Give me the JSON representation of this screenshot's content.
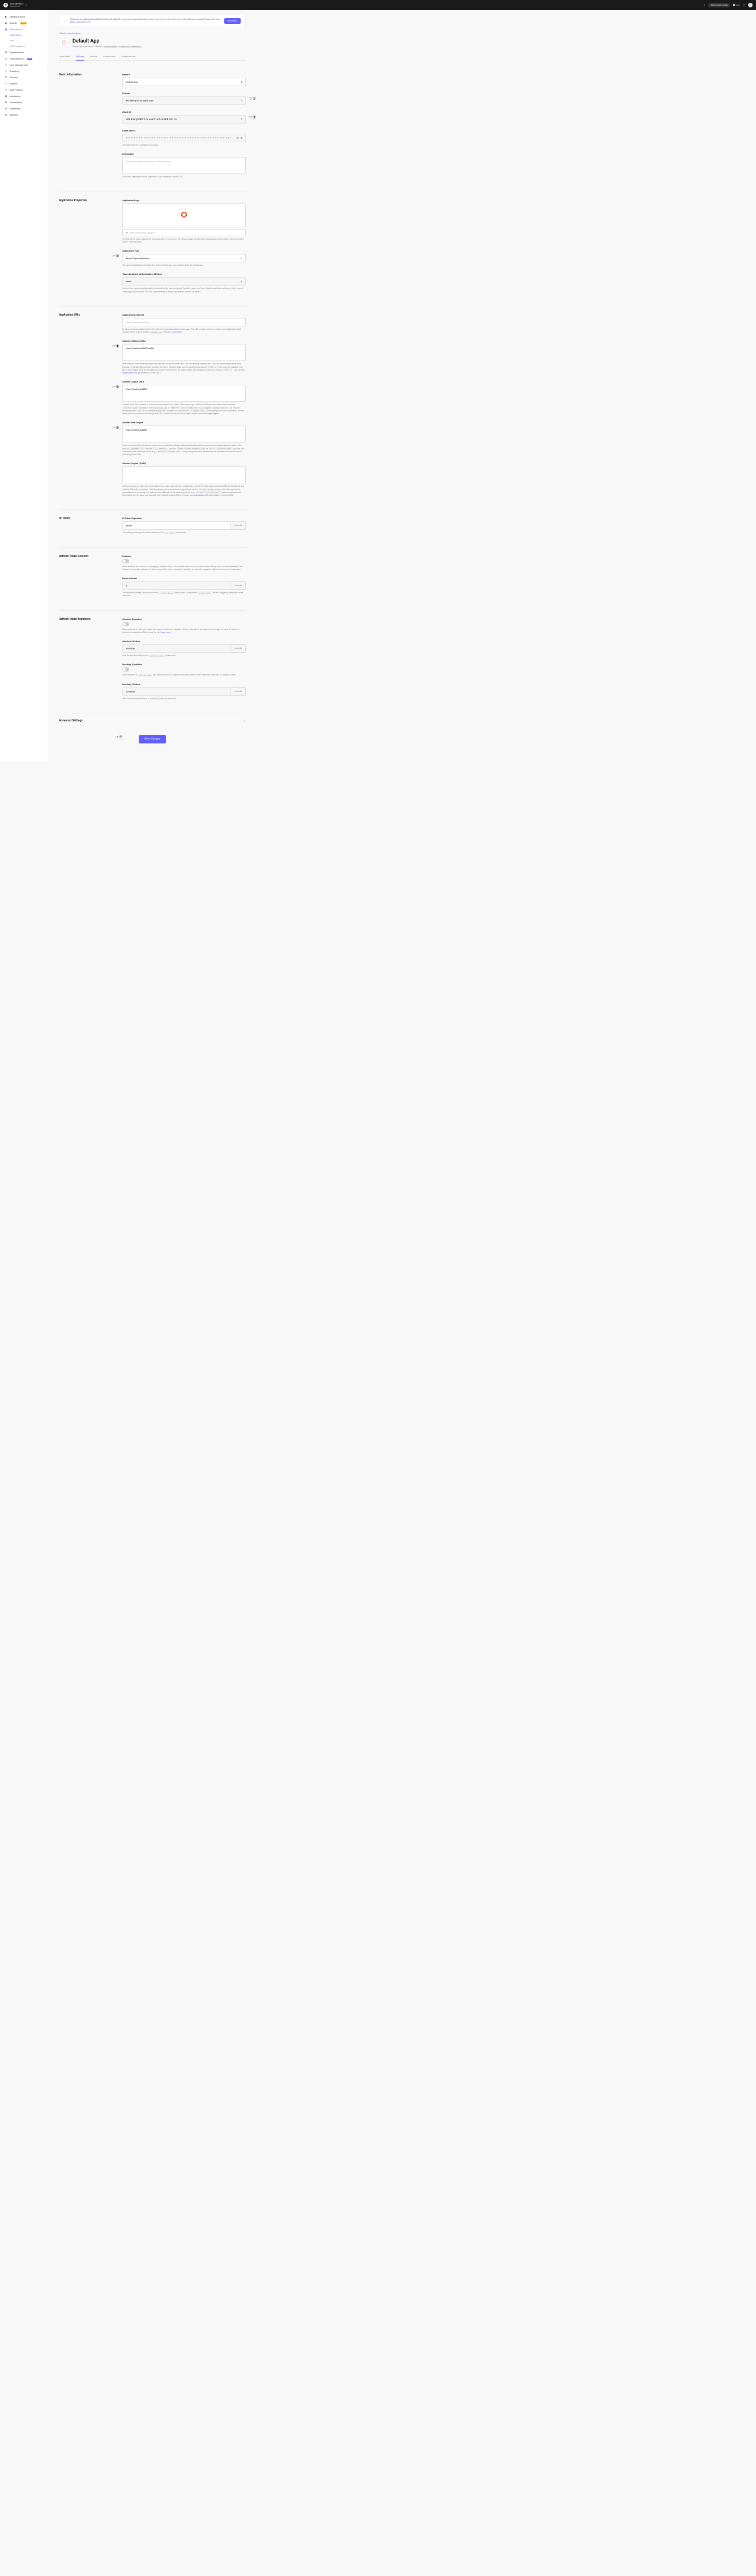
{
  "topbar": {
    "tenant_name": "dev-5tf99p7c",
    "tenant_env": "Development",
    "discuss": "Discuss your needs",
    "docs": "Docs"
  },
  "sidebar": {
    "items": [
      {
        "icon": "▶",
        "label": "Getting Started"
      },
      {
        "icon": "◉",
        "label": "Activity",
        "badge": "FIRST"
      },
      {
        "icon": "▦",
        "label": "Applications",
        "active": true,
        "expanded": true,
        "children": [
          {
            "label": "Applications",
            "active": true
          },
          {
            "label": "APIs"
          },
          {
            "label": "SSO Integrations"
          }
        ]
      },
      {
        "icon": "⌘",
        "label": "Authentication"
      },
      {
        "icon": "▭",
        "label": "Organizations",
        "badge": "NEW"
      },
      {
        "icon": "☺",
        "label": "User Management"
      },
      {
        "icon": "✎",
        "label": "Branding"
      },
      {
        "icon": "⛨",
        "label": "Security"
      },
      {
        "icon": "⚡",
        "label": "Actions"
      },
      {
        "icon": "↗",
        "label": "Auth Pipeline"
      },
      {
        "icon": "▤",
        "label": "Monitoring"
      },
      {
        "icon": "⊞",
        "label": "Marketplace"
      },
      {
        "icon": "⊕",
        "label": "Extensions"
      },
      {
        "icon": "⚙",
        "label": "Settings"
      }
    ]
  },
  "banner": {
    "text_prefix": "Thank you for signing up for Auth0! You have 22 days left in your trial to experiment with ",
    "link1": "features that are not in the Starter plan",
    "text_mid": ". Like what you're seeing? Please enter your ",
    "link2": "billing information here",
    "text_suffix": ".",
    "button": "View Plans"
  },
  "back_link": "Back to Applications",
  "app": {
    "name": "Default App",
    "type_label": "Single Page Application",
    "client_id_label": "Client ID:",
    "client_id": "GBPB42qhMRCtvrwGWYxw5cbhKKk8nzG"
  },
  "tabs": [
    "Quick Start",
    "Settings",
    "Addons",
    "Connections",
    "Organizations"
  ],
  "active_tab": "Settings",
  "sections": {
    "basic": {
      "title": "Basic Information",
      "name_label": "Name *",
      "name_value": "Default App",
      "domain_label": "Domain",
      "domain_value": "dev-5tf99p7c.us.auth0.com",
      "clientid_label": "Client ID",
      "clientid_value": "GBPB42qhMRCtvrwGWYxw5cbhKKk8nzG",
      "secret_label": "Client Secret",
      "secret_value": "••••••••••••••••••••••••••••••••••••••••••••••••••••••••••••••••",
      "secret_help": "The Client Secret is not base64 encoded.",
      "desc_label": "Description",
      "desc_placeholder": "Add a description in less than 140 characters",
      "desc_help": "A free text description of the application. Max character count is 140."
    },
    "props": {
      "title": "Application Properties",
      "logo_label": "Application Logo",
      "logo_url_placeholder": "https://path.to/my_logo.png",
      "logo_help": "The URL of the logo to display for the application, if none is set the default badge for this type of application will be shown. Recommended size is 150x150 pixels.",
      "apptype_label": "Application Type",
      "apptype_value": "Single Page Application",
      "apptype_help": "The type of application will determine which settings you can configure from the dashboard.",
      "tokenauth_label": "Token Endpoint Authentication Method",
      "tokenauth_value": "None",
      "tokenauth_help": "Defines the requested authentication method for the token endpoint. Possible values are 'None' (public application without a client secret), 'Post' (application uses HTTP POST parameters) or 'Basic' (application uses HTTP Basic)."
    },
    "uris": {
      "title": "Application URIs",
      "login_label": "Application Login URI",
      "login_placeholder": "https://myapp.org/login",
      "login_help_prefix": "In some scenarios, Auth0 will need to redirect to your application's login page. This URI needs to point to a route in your application that should redirect to your tenant's ",
      "login_help_code": "/authorize",
      "login_help_suffix": " endpoint. ",
      "login_help_link": "Learn more",
      "callback_label": "Allowed Callback URLs",
      "callback_value": "http://localhost:4200/profile",
      "callback_help_p1": "After the user authenticates we will only call back to any of these URLs. You can specify multiple valid URLs by comma-separating them (typically to handle different environments like QA or testing). Make sure to specify the protocol (",
      "callback_help_c1": "https://",
      "callback_help_p2": ") otherwise the callback may fail in some cases. With the exception of custom URI schemes for native clients, all callbacks should use protocol ",
      "callback_help_c2": "https://",
      "callback_help_p3": ". You can use ",
      "callback_help_link": "Organization URL",
      "callback_help_p4": " parameters in these URLs.",
      "logout_label": "Allowed Logout URLs",
      "logout_value": "http://localhost:4200",
      "logout_help_p1": "A set of URLs that are valid to redirect to after logout from Auth0. After a user logs out from Auth0 you can redirect them with the ",
      "logout_help_c1": "returnTo",
      "logout_help_p2": " query parameter. The URL that you use in ",
      "logout_help_c2": "returnTo",
      "logout_help_p3": " must be listed here. You can specify multiple valid URLs by comma-separating them. You can use the star symbol as a wildcard for subdomains (",
      "logout_help_c3": "*.google.com",
      "logout_help_p4": "). Query strings and hash information are not taken into account when validating these URLs. Read more about this at ",
      "logout_help_link": "https://auth0.com/docs/login/logout",
      "webo_label": "Allowed Web Origins",
      "webo_value": "http://localhost:4200",
      "webo_help_p1": "Comma-separated list of allowed origins for use with ",
      "webo_help_l1": "Cross-Origin Authentication",
      "webo_help_p2": ", ",
      "webo_help_l2": "Device Flow",
      "webo_help_p3": ", and ",
      "webo_help_l3": "web message response mode",
      "webo_help_p4": ", in the form of ",
      "webo_help_c1": "<scheme> \"://\" <host> [ \":\" <port> ]",
      "webo_help_p5": ", such as ",
      "webo_help_c2": "https://login.mydomain.com",
      "webo_help_p6": " or ",
      "webo_help_c3": "http://localhost:3000",
      "webo_help_p7": ". You can use wildcards at the subdomain level (e.g.: ",
      "webo_help_c4": "https://*.contoso.com",
      "webo_help_p8": "). Query strings and hash information are not taken into account when validating these URLs.",
      "cors_label": "Allowed Origins (CORS)",
      "cors_value": "",
      "cors_help_p1": "Allowed Origins are URLs that will be allowed to make requests from JavaScript to Auth0 API (typically used with CORS). By default, all your callback URLs will be allowed. This field allows you to enter other origins if you need to. You can specify multiple valid URLs by comma-separating them or one by line, and also use wildcards at the subdomain level (e.g.: ",
      "cors_help_c1": "https://*.contoso.com",
      "cors_help_p2": "). Query strings and hash information are not taken into account when validating these URLs.. You can use ",
      "cors_help_link": "Organization URL",
      "cors_help_p3": " placeholders in these URLs."
    },
    "idtoken": {
      "title": "ID Token",
      "exp_label": "ID Token Expiration",
      "exp_value": "36000",
      "exp_unit": "seconds",
      "exp_help_p1": "This setting allows you to set the lifetime of the ",
      "exp_help_code": "id_token",
      "exp_help_p2": " (in seconds)"
    },
    "rotation": {
      "title": "Refresh Token Rotation",
      "rot_label": "Rotation",
      "rot_help_p1": "When enabled, as a result of exchanging a refresh token, a new refresh token will be issued and the existing token will be invalidated. This allows for automatic detection of token reuse if the token is leaked. In addition, an absolute expiration lifetime must be set. ",
      "rot_help_link": "Learn more",
      "reuse_label": "Reuse Interval",
      "reuse_value": "0",
      "reuse_unit": "seconds",
      "reuse_help_p1": "The allowable leeway time that the same ",
      "reuse_help_c1": "refresh_token",
      "reuse_help_p2": " can be used to request an ",
      "reuse_help_c2": "access_token",
      "reuse_help_p3": " without triggering automatic reuse detection."
    },
    "expiration": {
      "title": "Refresh Token Expiration",
      "abs_label": "Absolute Expiration",
      "abs_help_p1": "When enabled, a ",
      "abs_help_c1": "refresh_token",
      "abs_help_p2": " will expire based on an absolute lifetime, after which the token can no longer be used. If rotation is enabled, an expiration lifetime must be set. ",
      "abs_help_link": "Learn more",
      "abslife_label": "Absolute Lifetime",
      "abslife_value": "2592000",
      "abslife_unit": "seconds",
      "abslife_help_p1": "Sets the absolute lifetime of a ",
      "abslife_help_c1": "refresh_token",
      "abslife_help_p2": " (in seconds).",
      "inact_label": "Inactivity Expiration",
      "inact_help_p1": "When enabled, a ",
      "inact_help_c1": "refresh_token",
      "inact_help_p2": " will expire based on a specified inactivity lifetime, after which the token can no longer be used.",
      "inactlife_label": "Inactivity Lifetime",
      "inactlife_value": "1296000",
      "inactlife_unit": "seconds",
      "inactlife_help_p1": "Sets the inactivity lifetime of a ",
      "inactlife_help_c1": "refresh_token",
      "inactlife_help_p2": " (in seconds)."
    },
    "advanced": "Advanced Settings",
    "save": "Save Changes"
  }
}
